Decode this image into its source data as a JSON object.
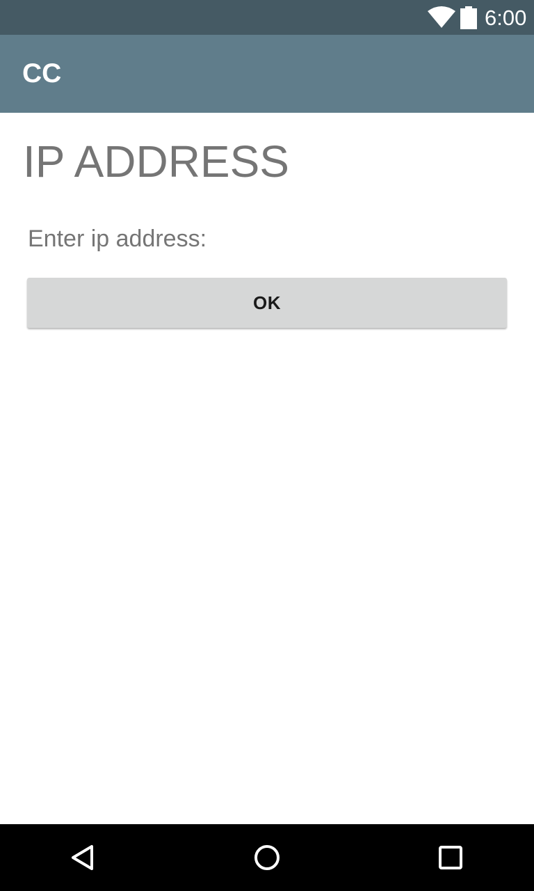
{
  "status_bar": {
    "time": "6:00",
    "icons": [
      "wifi-icon",
      "battery-icon"
    ]
  },
  "toolbar": {
    "title": "CC"
  },
  "main": {
    "heading": "IP ADDRESS",
    "prompt": "Enter ip address:",
    "ok_label": "OK"
  },
  "nav_bar": {
    "icons": [
      "back-icon",
      "home-icon",
      "recents-icon"
    ]
  },
  "colors": {
    "status_bar": "#455a64",
    "toolbar": "#607d8b",
    "button": "#d6d7d7",
    "text_secondary": "#757575"
  }
}
